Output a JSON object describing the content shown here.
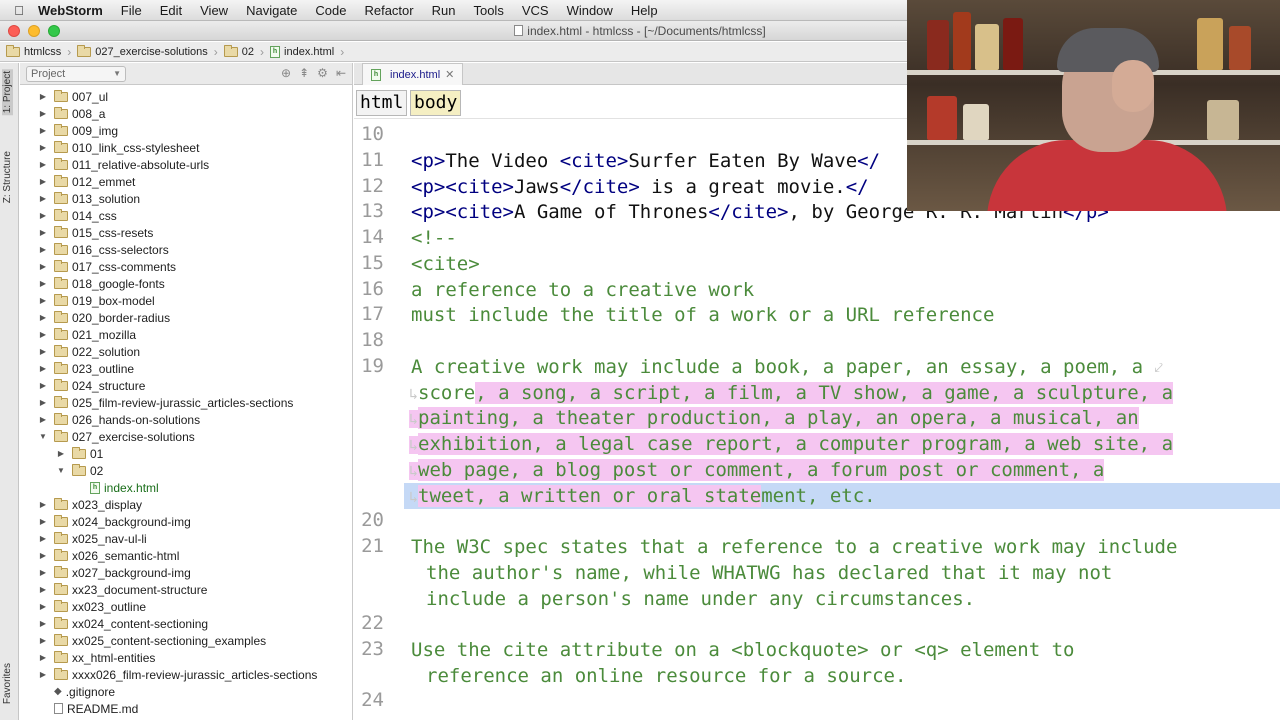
{
  "menubar": {
    "app_name": "WebStorm",
    "items": [
      "File",
      "Edit",
      "View",
      "Navigate",
      "Code",
      "Refactor",
      "Run",
      "Tools",
      "VCS",
      "Window",
      "Help"
    ]
  },
  "window": {
    "title": "index.html - htmlcss - [~/Documents/htmlcss]"
  },
  "navbar": {
    "crumbs": [
      "htmlcss",
      "027_exercise-solutions",
      "02",
      "index.html"
    ]
  },
  "toolstrip": {
    "project_tab": "1: Project",
    "structure_tab": "Z: Structure",
    "favorites_tab": "Favorites"
  },
  "project_panel": {
    "view_label": "Project",
    "tree": [
      {
        "name": "007_ul",
        "type": "folder",
        "depth": 0,
        "expanded": false
      },
      {
        "name": "008_a",
        "type": "folder",
        "depth": 0,
        "expanded": false
      },
      {
        "name": "009_img",
        "type": "folder",
        "depth": 0,
        "expanded": false
      },
      {
        "name": "010_link_css-stylesheet",
        "type": "folder",
        "depth": 0,
        "expanded": false
      },
      {
        "name": "011_relative-absolute-urls",
        "type": "folder",
        "depth": 0,
        "expanded": false
      },
      {
        "name": "012_emmet",
        "type": "folder",
        "depth": 0,
        "expanded": false
      },
      {
        "name": "013_solution",
        "type": "folder",
        "depth": 0,
        "expanded": false
      },
      {
        "name": "014_css",
        "type": "folder",
        "depth": 0,
        "expanded": false
      },
      {
        "name": "015_css-resets",
        "type": "folder",
        "depth": 0,
        "expanded": false
      },
      {
        "name": "016_css-selectors",
        "type": "folder",
        "depth": 0,
        "expanded": false
      },
      {
        "name": "017_css-comments",
        "type": "folder",
        "depth": 0,
        "expanded": false
      },
      {
        "name": "018_google-fonts",
        "type": "folder",
        "depth": 0,
        "expanded": false
      },
      {
        "name": "019_box-model",
        "type": "folder",
        "depth": 0,
        "expanded": false
      },
      {
        "name": "020_border-radius",
        "type": "folder",
        "depth": 0,
        "expanded": false
      },
      {
        "name": "021_mozilla",
        "type": "folder",
        "depth": 0,
        "expanded": false
      },
      {
        "name": "022_solution",
        "type": "folder",
        "depth": 0,
        "expanded": false
      },
      {
        "name": "023_outline",
        "type": "folder",
        "depth": 0,
        "expanded": false
      },
      {
        "name": "024_structure",
        "type": "folder",
        "depth": 0,
        "expanded": false
      },
      {
        "name": "025_film-review-jurassic_articles-sections",
        "type": "folder",
        "depth": 0,
        "expanded": false
      },
      {
        "name": "026_hands-on-solutions",
        "type": "folder",
        "depth": 0,
        "expanded": false
      },
      {
        "name": "027_exercise-solutions",
        "type": "folder",
        "depth": 0,
        "expanded": true
      },
      {
        "name": "01",
        "type": "folder",
        "depth": 1,
        "expanded": false
      },
      {
        "name": "02",
        "type": "folder",
        "depth": 1,
        "expanded": true
      },
      {
        "name": "index.html",
        "type": "html",
        "depth": 2,
        "expanded": false
      },
      {
        "name": "x023_display",
        "type": "folder",
        "depth": 0,
        "expanded": false
      },
      {
        "name": "x024_background-img",
        "type": "folder",
        "depth": 0,
        "expanded": false
      },
      {
        "name": "x025_nav-ul-li",
        "type": "folder",
        "depth": 0,
        "expanded": false
      },
      {
        "name": "x026_semantic-html",
        "type": "folder",
        "depth": 0,
        "expanded": false
      },
      {
        "name": "x027_background-img",
        "type": "folder",
        "depth": 0,
        "expanded": false
      },
      {
        "name": "xx23_document-structure",
        "type": "folder",
        "depth": 0,
        "expanded": false
      },
      {
        "name": "xx023_outline",
        "type": "folder",
        "depth": 0,
        "expanded": false
      },
      {
        "name": "xx024_content-sectioning",
        "type": "folder",
        "depth": 0,
        "expanded": false
      },
      {
        "name": "xx025_content-sectioning_examples",
        "type": "folder",
        "depth": 0,
        "expanded": false
      },
      {
        "name": "xx_html-entities",
        "type": "folder",
        "depth": 0,
        "expanded": false
      },
      {
        "name": "xxxx026_film-review-jurassic_articles-sections",
        "type": "folder",
        "depth": 0,
        "expanded": false
      },
      {
        "name": ".gitignore",
        "type": "git",
        "depth": 0,
        "expanded": false
      },
      {
        "name": "README.md",
        "type": "md",
        "depth": 0,
        "expanded": false
      }
    ]
  },
  "editor": {
    "tab_label": "index.html",
    "tag_breadcrumb": [
      "html",
      "body"
    ],
    "line_numbers": [
      "10",
      "11",
      "12",
      "13",
      "14",
      "15",
      "16",
      "17",
      "18",
      "19",
      "20",
      "21",
      "22",
      "23",
      "24"
    ],
    "lines": {
      "l11_open": "<p>",
      "l11_text1": "The Video ",
      "l11_cite_open": "<cite>",
      "l11_text2": "Surfer Eaten By Wave",
      "l11_close": "</",
      "l12_open": "<p><cite>",
      "l12_text1": "Jaws",
      "l12_cite_close": "</cite>",
      "l12_text2": " is a great movie.",
      "l12_close": "</",
      "l13_open": "<p><cite>",
      "l13_text1": "A Game of Thrones",
      "l13_cite_close": "</cite>",
      "l13_text2": ", by George R. R. Martin",
      "l13_close": "</p>",
      "l14": "<!--",
      "l15": "<cite>",
      "l16": "a reference to a creative work",
      "l17": "must include the title of a work or a URL reference",
      "l19_a": "A creative work may include a book, a paper, an essay, a poem, a",
      "l19_b1": "score",
      "l19_b2": ", a song, a script, a film, a TV show, a game, a sculpture, a",
      "l19_c": "painting, a theater production, a play, an opera, a musical, an",
      "l19_d": "exhibition, a legal case report, a computer program, a web site, a",
      "l19_e": "web page, a blog post or comment, a forum post or comment, a",
      "l19_f1": "tweet, a written or oral state",
      "l19_f2": "ment, etc.",
      "l21_a": "The W3C spec states that a reference to a creative work may include",
      "l21_b": "the author's name, while WHATWG has declared that it may not",
      "l21_c": "include a person's name under any circumstances.",
      "l23_a": "Use the cite attribute on a <blockquote> or <q> element to",
      "l23_b": "reference an online resource for a source."
    }
  },
  "colors": {
    "tag": "#000080",
    "comment": "#4b8b3b",
    "selection_pink": "#f5c6f1",
    "current_line": "#c5d9f6"
  }
}
